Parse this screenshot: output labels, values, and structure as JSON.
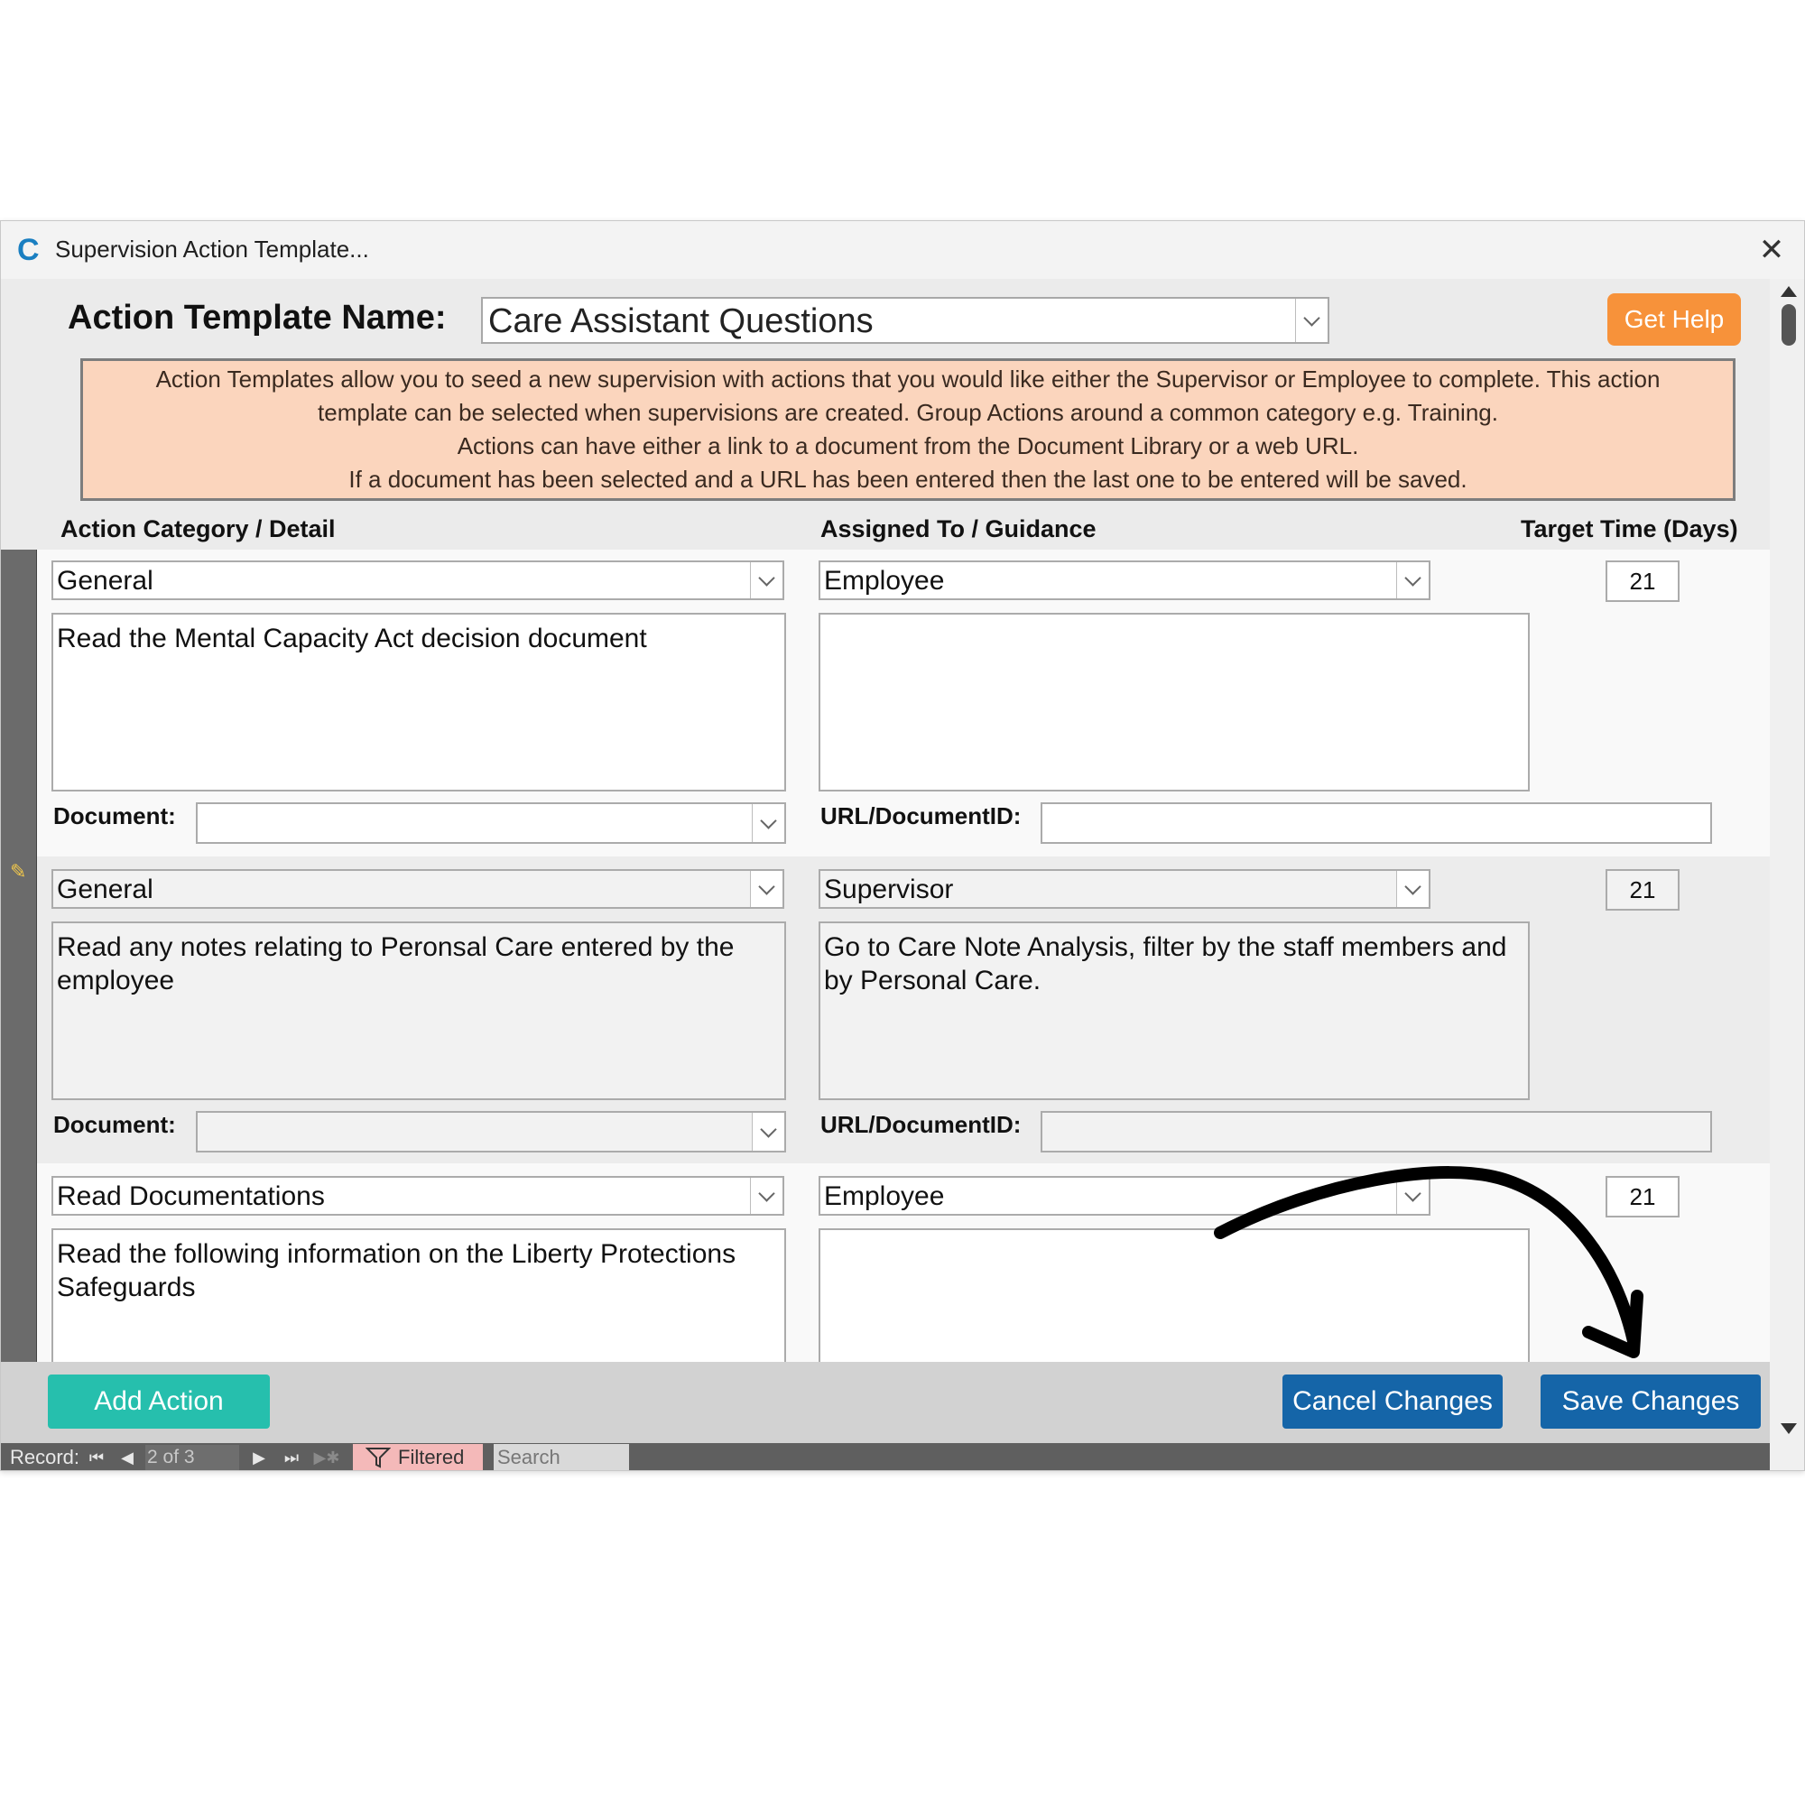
{
  "window": {
    "title": "Supervision Action Template...",
    "logo_letter": "C",
    "close_glyph": "✕"
  },
  "header": {
    "name_label": "Action Template Name:",
    "name_value": "Care Assistant Questions",
    "help_label": "Get Help",
    "info_lines": [
      "Action Templates allow you to seed a new supervision with actions that you would like either the Supervisor or Employee to complete.  This action",
      "template can be selected when supervisions are created.  Group Actions around a common category e.g. Training.",
      "Actions can have either a link to a document from the Document Library or a web URL.",
      "If a document has been selected and a URL has been entered then the last one to be entered will be saved."
    ],
    "columns": {
      "category": "Action Category / Detail",
      "assigned": "Assigned To / Guidance",
      "target": "Target Time (Days)"
    }
  },
  "labels": {
    "document": "Document:",
    "url": "URL/DocumentID:"
  },
  "records": [
    {
      "category": "General",
      "detail": "Read the Mental Capacity Act decision document",
      "assigned": "Employee",
      "guidance": "",
      "target": "21",
      "document": "",
      "url": ""
    },
    {
      "category": "General",
      "detail": "Read any notes relating to Peronsal Care entered by the employee",
      "assigned": "Supervisor",
      "guidance": "Go to Care Note Analysis, filter by the staff members and by Personal Care.",
      "target": "21",
      "document": "",
      "url": ""
    },
    {
      "category": "Read Documentations",
      "detail": "Read the following information on the Liberty Protections Safeguards",
      "assigned": "Employee",
      "guidance": "",
      "target": "21"
    }
  ],
  "footer": {
    "add_label": "Add Action",
    "cancel_label": "Cancel Changes",
    "save_label": "Save Changes"
  },
  "navbar": {
    "record_label": "Record:",
    "position": "2 of 3",
    "filter_label": "Filtered",
    "search_placeholder": "Search"
  },
  "colors": {
    "help_button": "#f7923a",
    "add_button": "#26bfad",
    "primary_button": "#1565a8",
    "info_box": "#fbd5bd",
    "filter_badge": "#f4b9b9"
  },
  "icons": {
    "first": "⏮",
    "prev": "◀",
    "next": "▶",
    "last": "⏭",
    "new": "▶✱",
    "edit": "✎"
  }
}
